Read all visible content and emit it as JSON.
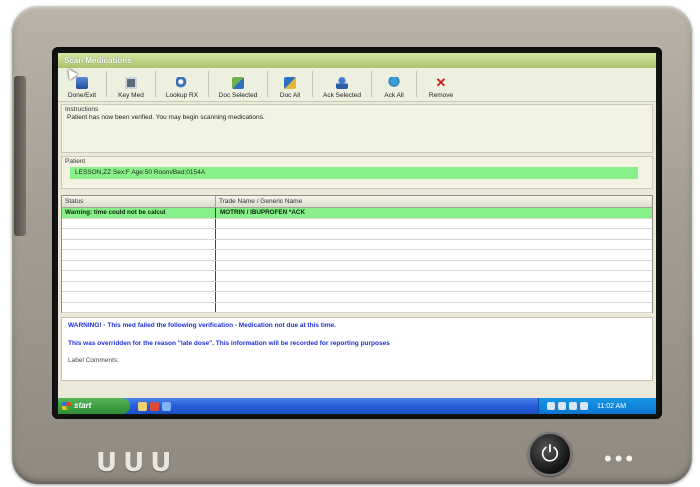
{
  "app": {
    "title": "Scan Medications"
  },
  "toolbar": {
    "buttons": [
      {
        "label": "Done/Exit",
        "icon": "door-exit-icon"
      },
      {
        "label": "Key Med",
        "icon": "keyboard-icon"
      },
      {
        "label": "Lookup RX",
        "icon": "magnifier-icon"
      },
      {
        "label": "Doc Selected",
        "icon": "document-select-icon"
      },
      {
        "label": "Doc All",
        "icon": "document-all-icon"
      },
      {
        "label": "Ack Selected",
        "icon": "person-ack-icon"
      },
      {
        "label": "Ack All",
        "icon": "globe-ack-icon"
      },
      {
        "label": "Remove",
        "icon": "red-x-icon"
      }
    ]
  },
  "instructions": {
    "caption": "Instructions",
    "text": "Patient has now been verified.  You may begin scanning medications."
  },
  "patient": {
    "caption": "Patient",
    "info": "LESSON,ZZ  Sex:F   Age:50   Room/Bed:0154A"
  },
  "grid": {
    "columns": [
      "Status",
      "Trade Name / Generic Name"
    ],
    "rows": [
      {
        "status": "Warning: time could not be calcul",
        "name": "MOTRIN / IBUPROFEN *ACK"
      }
    ],
    "highlight_color": "#88f08a"
  },
  "warning": {
    "line1": "WARNING! - This med failed the following verification - Medication not due at this time.",
    "line2": "This was overridden for the reason \"late dose\". This information will be recorded for reporting purposes",
    "label_comments": "Label Comments:",
    "text_color": "#1f2fd6"
  },
  "taskbar": {
    "start_label": "start",
    "clock": "11:02 AM"
  },
  "device": {
    "logo": "UUU",
    "dots": "•••"
  }
}
